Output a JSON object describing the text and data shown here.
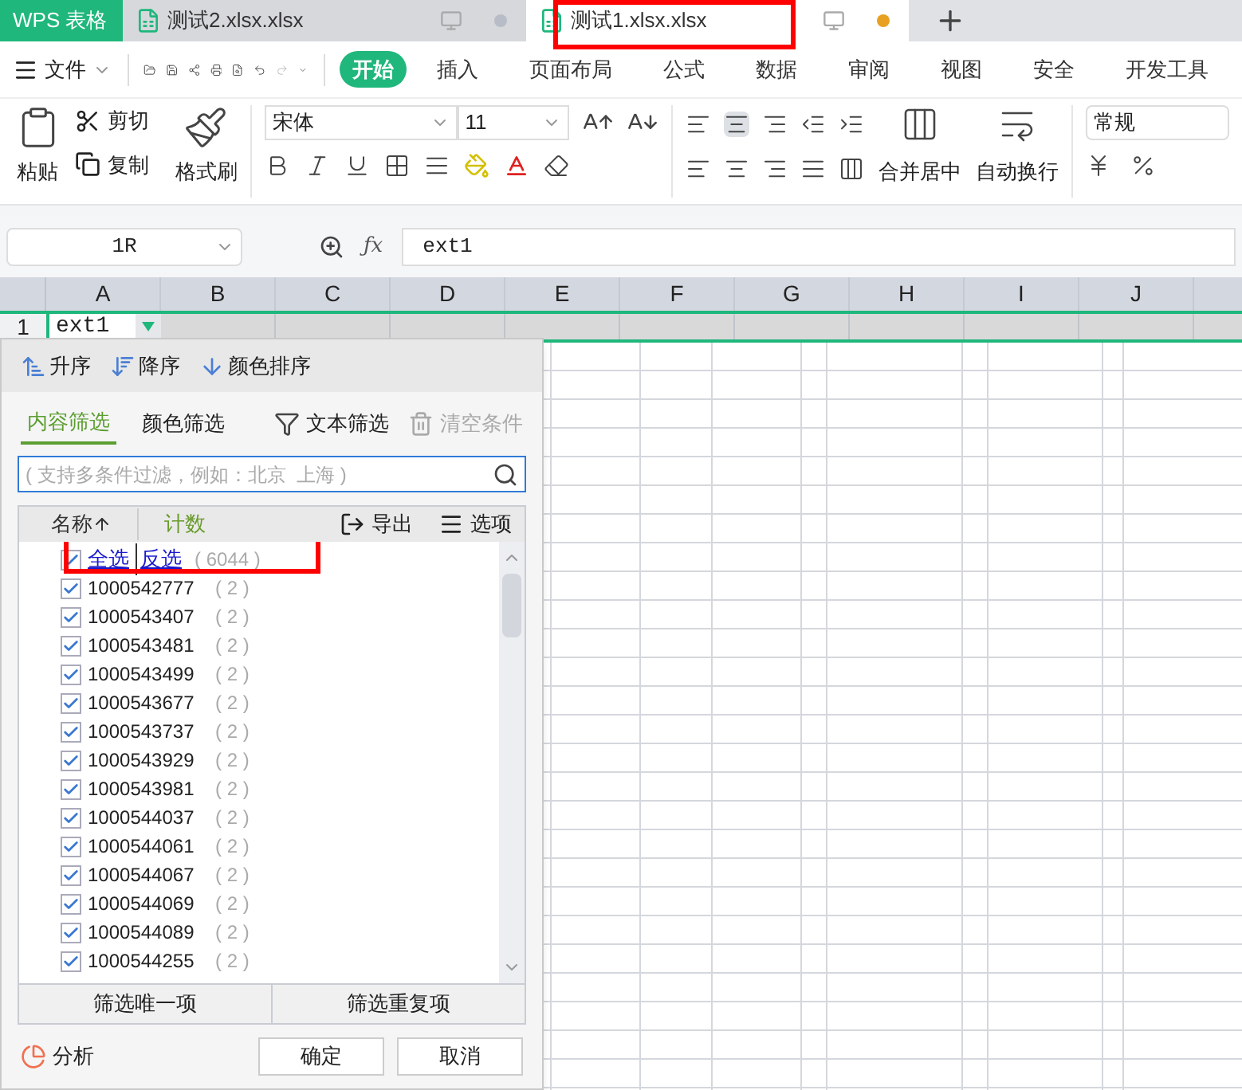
{
  "app_tab": {
    "label": "WPS 表格"
  },
  "doc_tabs": [
    {
      "label": "测试2.xlsx.xlsx",
      "selected": false,
      "modified": false,
      "highlighted": false
    },
    {
      "label": "测试1.xlsx.xlsx",
      "selected": true,
      "modified": true,
      "highlighted": true
    }
  ],
  "menu": {
    "file": "文件",
    "items": [
      {
        "label": "开始",
        "selected": true
      },
      {
        "label": "插入",
        "selected": false
      },
      {
        "label": "页面布局",
        "selected": false
      },
      {
        "label": "公式",
        "selected": false
      },
      {
        "label": "数据",
        "selected": false
      },
      {
        "label": "审阅",
        "selected": false
      },
      {
        "label": "视图",
        "selected": false
      },
      {
        "label": "安全",
        "selected": false
      },
      {
        "label": "开发工具",
        "selected": false
      }
    ]
  },
  "ribbon": {
    "paste": "粘贴",
    "cut": "剪切",
    "copy": "复制",
    "format_painter": "格式刷",
    "font": "宋体",
    "font_size": "11",
    "merge": "合并居中",
    "wrap": "自动换行",
    "number_format": "常规"
  },
  "formula_bar": {
    "name_box": "1R",
    "fx": "ƒx",
    "formula": "ext1"
  },
  "sheet": {
    "columns": [
      "A",
      "B",
      "C",
      "D",
      "E",
      "F",
      "G",
      "H",
      "I",
      "J"
    ],
    "row_1": "1",
    "cell_a1": "ext1"
  },
  "filter": {
    "sort": [
      "升序",
      "降序",
      "颜色排序"
    ],
    "tabs": [
      {
        "label": "内容筛选",
        "selected": true
      },
      {
        "label": "颜色筛选",
        "selected": false
      }
    ],
    "text_filter": "文本筛选",
    "clear": {
      "label": "清空条件",
      "disabled": true
    },
    "search": {
      "placeholder": "( 支持多条件过滤，例如：北京  上海 )"
    },
    "header": {
      "name": "名称",
      "count": "计数",
      "export": "导出",
      "options": "选项"
    },
    "select_all": {
      "all": "全选",
      "invert": "反选",
      "count": "( 6044 )",
      "checked": true,
      "highlighted": true
    },
    "items": [
      {
        "value": "1000542777",
        "count": "( 2 )",
        "checked": true
      },
      {
        "value": "1000543407",
        "count": "( 2 )",
        "checked": true
      },
      {
        "value": "1000543481",
        "count": "( 2 )",
        "checked": true
      },
      {
        "value": "1000543499",
        "count": "( 2 )",
        "checked": true
      },
      {
        "value": "1000543677",
        "count": "( 2 )",
        "checked": true
      },
      {
        "value": "1000543737",
        "count": "( 2 )",
        "checked": true
      },
      {
        "value": "1000543929",
        "count": "( 2 )",
        "checked": true
      },
      {
        "value": "1000543981",
        "count": "( 2 )",
        "checked": true
      },
      {
        "value": "1000544037",
        "count": "( 2 )",
        "checked": true
      },
      {
        "value": "1000544061",
        "count": "( 2 )",
        "checked": true
      },
      {
        "value": "1000544067",
        "count": "( 2 )",
        "checked": true
      },
      {
        "value": "1000544069",
        "count": "( 2 )",
        "checked": true
      },
      {
        "value": "1000544089",
        "count": "( 2 )",
        "checked": true
      },
      {
        "value": "1000544255",
        "count": "( 2 )",
        "checked": true
      }
    ],
    "quick": [
      "筛选唯一项",
      "筛选重复项"
    ],
    "analyze": "分析",
    "ok": "确定",
    "cancel": "取消"
  }
}
